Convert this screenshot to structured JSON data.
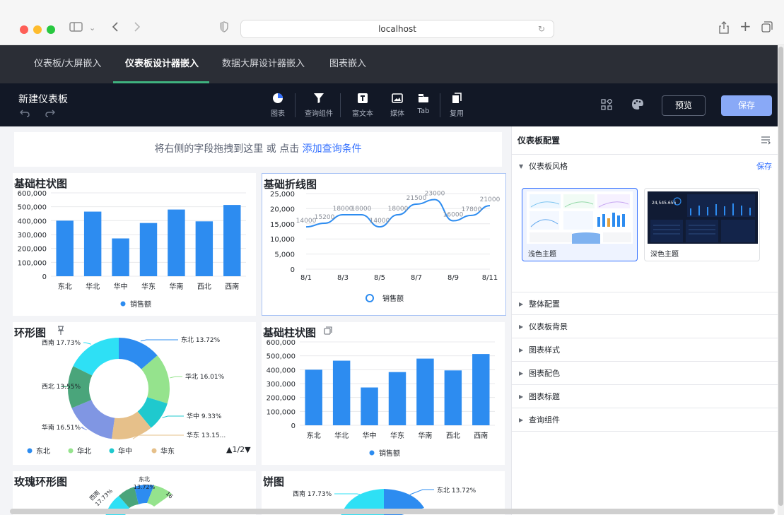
{
  "browser": {
    "url": "localhost"
  },
  "app_tabs": [
    {
      "label": "仪表板/大屏嵌入",
      "active": false
    },
    {
      "label": "仪表板设计器嵌入",
      "active": true
    },
    {
      "label": "数据大屏设计器嵌入",
      "active": false
    },
    {
      "label": "图表嵌入",
      "active": false
    }
  ],
  "designer": {
    "title": "新建仪表板",
    "tools": [
      "图表",
      "查询组件",
      "富文本",
      "媒体",
      "Tab",
      "复用"
    ],
    "preview_label": "预览",
    "save_label": "保存"
  },
  "query_bar": {
    "text": "将右侧的字段拖拽到这里 或 点击",
    "link": "添加查询条件"
  },
  "panels": {
    "bar1_title": "基础柱状图",
    "line_title": "基础折线图",
    "donut_title": "环形图",
    "bar2_title": "基础柱状图",
    "rose_title": "玫瑰环形图",
    "pie_title": "饼图",
    "legend_page": "▲1/2▼"
  },
  "chart_data": [
    {
      "type": "bar",
      "title": "基础柱状图",
      "categories": [
        "东北",
        "华北",
        "华中",
        "华东",
        "华南",
        "西北",
        "西南"
      ],
      "series": [
        {
          "name": "销售额",
          "values": [
            400000,
            465000,
            272000,
            383000,
            480000,
            395000,
            513000
          ]
        }
      ],
      "yticks": [
        "600,000",
        "500,000",
        "400,000",
        "300,000",
        "200,000",
        "100,000",
        "0"
      ],
      "ylim": [
        0,
        600000
      ],
      "color": "#2d8cf0"
    },
    {
      "type": "line",
      "title": "基础折线图",
      "x": [
        "8/1",
        "8/2",
        "8/3",
        "8/4",
        "8/5",
        "8/6",
        "8/7",
        "8/8",
        "8/9",
        "8/10",
        "8/11"
      ],
      "xticks": [
        "8/1",
        "8/3",
        "8/5",
        "8/7",
        "8/9",
        "8/11"
      ],
      "series": [
        {
          "name": "销售额",
          "values": [
            14000,
            15200,
            18000,
            18000,
            14000,
            18000,
            21500,
            23000,
            16000,
            17800,
            21000
          ]
        }
      ],
      "value_labels": [
        "14000",
        "15200",
        "18000",
        "18000",
        "14000",
        "18000",
        "21500",
        "23000",
        "16000",
        "17800",
        "21000"
      ],
      "yticks": [
        "25,000",
        "20,000",
        "15,000",
        "10,000",
        "5,000",
        "0"
      ],
      "ylim": [
        0,
        25000
      ],
      "color": "#2d8cf0"
    },
    {
      "type": "pie",
      "title": "环形图",
      "slices": [
        {
          "label": "东北",
          "pct": 13.72,
          "text": "东北 13.72%",
          "color": "#2d8cf0"
        },
        {
          "label": "华北",
          "pct": 16.01,
          "text": "华北 16.01%",
          "color": "#95e38d"
        },
        {
          "label": "华中",
          "pct": 9.33,
          "text": "华中 9.33%",
          "color": "#1fc9ce"
        },
        {
          "label": "华东",
          "pct": 13.15,
          "text": "华东 13.15...",
          "color": "#e6c08a"
        },
        {
          "label": "华南",
          "pct": 16.51,
          "text": "华南 16.51%",
          "color": "#8096e3"
        },
        {
          "label": "西北",
          "pct": 13.55,
          "text": "西北 13.55%",
          "color": "#4aa57b"
        },
        {
          "label": "西南",
          "pct": 17.73,
          "text": "西南 17.73%",
          "color": "#2ee0f5"
        }
      ],
      "legend": [
        "东北",
        "华北",
        "华中",
        "华东"
      ]
    },
    {
      "type": "bar",
      "title": "基础柱状图",
      "categories": [
        "东北",
        "华北",
        "华中",
        "华东",
        "华南",
        "西北",
        "西南"
      ],
      "series": [
        {
          "name": "销售额",
          "values": [
            400000,
            465000,
            272000,
            383000,
            480000,
            395000,
            513000
          ]
        }
      ],
      "yticks": [
        "600,000",
        "500,000",
        "400,000",
        "300,000",
        "200,000",
        "100,000",
        "0"
      ],
      "ylim": [
        0,
        600000
      ],
      "color": "#2d8cf0"
    }
  ],
  "rose_labels": [
    "东北",
    "13.72%",
    "西南",
    "17.73%",
    "16"
  ],
  "pie_labels": [
    "西南 17.73%",
    "东北 13.72%"
  ],
  "right_panel": {
    "title": "仪表板配置",
    "style_section": "仪表板风格",
    "save_link": "保存",
    "themes": [
      {
        "label": "浅色主题",
        "selected": true,
        "mini_value": ""
      },
      {
        "label": "深色主题",
        "selected": false,
        "mini_value": "24,545.656"
      }
    ],
    "sections": [
      "整体配置",
      "仪表板背景",
      "图表样式",
      "图表配色",
      "图表标题",
      "查询组件"
    ]
  }
}
